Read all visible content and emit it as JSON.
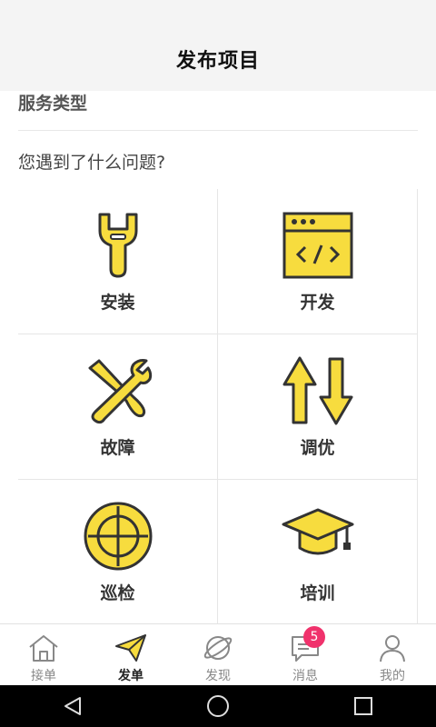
{
  "header": {
    "title": "发布项目"
  },
  "section": {
    "title": "服务类型",
    "question": "您遇到了什么问题?"
  },
  "services": [
    {
      "label": "安装",
      "icon": "wrench-icon"
    },
    {
      "label": "开发",
      "icon": "code-window-icon"
    },
    {
      "label": "故障",
      "icon": "tools-icon"
    },
    {
      "label": "调优",
      "icon": "up-down-arrows-icon"
    },
    {
      "label": "巡检",
      "icon": "crosshair-icon"
    },
    {
      "label": "培训",
      "icon": "graduation-cap-icon"
    }
  ],
  "tabs": [
    {
      "label": "接单",
      "icon": "home-icon",
      "active": false
    },
    {
      "label": "发单",
      "icon": "paper-plane-icon",
      "active": true
    },
    {
      "label": "发现",
      "icon": "planet-icon",
      "active": false
    },
    {
      "label": "消息",
      "icon": "chat-icon",
      "active": false,
      "badge": "5"
    },
    {
      "label": "我的",
      "icon": "user-icon",
      "active": false
    }
  ],
  "colors": {
    "accent": "#f7dc3e",
    "outline": "#333333",
    "badge": "#f0326c"
  }
}
